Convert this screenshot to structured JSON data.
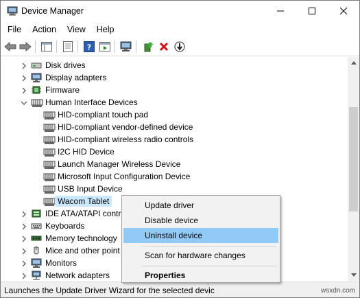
{
  "window": {
    "title": "Device Manager"
  },
  "menu": [
    "File",
    "Action",
    "View",
    "Help"
  ],
  "tree": {
    "rows": [
      {
        "label": "Disk drives",
        "expander": "collapsed",
        "icon": "disk-icon",
        "indent": 0
      },
      {
        "label": "Display adapters",
        "expander": "collapsed",
        "icon": "monitor-icon",
        "indent": 0
      },
      {
        "label": "Firmware",
        "expander": "collapsed",
        "icon": "chip-icon",
        "indent": 0
      },
      {
        "label": "Human Interface Devices",
        "expander": "expanded",
        "icon": "hid-icon",
        "indent": 0
      },
      {
        "label": "HID-compliant touch pad",
        "expander": "none",
        "icon": "hid-icon",
        "indent": 1
      },
      {
        "label": "HID-compliant vendor-defined device",
        "expander": "none",
        "icon": "hid-icon",
        "indent": 1
      },
      {
        "label": "HID-compliant wireless radio controls",
        "expander": "none",
        "icon": "hid-icon",
        "indent": 1
      },
      {
        "label": "I2C HID Device",
        "expander": "none",
        "icon": "hid-icon",
        "indent": 1
      },
      {
        "label": "Launch Manager Wireless Device",
        "expander": "none",
        "icon": "hid-icon",
        "indent": 1
      },
      {
        "label": "Microsoft Input Configuration Device",
        "expander": "none",
        "icon": "hid-icon",
        "indent": 1
      },
      {
        "label": "USB Input Device",
        "expander": "none",
        "icon": "hid-icon",
        "indent": 1
      },
      {
        "label": "Wacom Tablet",
        "expander": "none",
        "icon": "hid-icon",
        "indent": 1,
        "selected": true
      },
      {
        "label": "IDE ATA/ATAPI contro",
        "expander": "collapsed",
        "icon": "ide-icon",
        "indent": 0
      },
      {
        "label": "Keyboards",
        "expander": "collapsed",
        "icon": "keyboard-icon",
        "indent": 0
      },
      {
        "label": "Memory technology",
        "expander": "collapsed",
        "icon": "memory-icon",
        "indent": 0
      },
      {
        "label": "Mice and other point",
        "expander": "collapsed",
        "icon": "mouse-icon",
        "indent": 0
      },
      {
        "label": "Monitors",
        "expander": "collapsed",
        "icon": "monitor-icon",
        "indent": 0
      },
      {
        "label": "Network adapters",
        "expander": "collapsed",
        "icon": "network-icon",
        "indent": 0
      }
    ]
  },
  "context_menu": {
    "items": [
      {
        "label": "Update driver"
      },
      {
        "label": "Disable device"
      },
      {
        "label": "Uninstall device",
        "highlighted": true
      },
      {
        "label": "Scan for hardware changes"
      },
      {
        "label": "Properties",
        "bold": true
      }
    ]
  },
  "status": {
    "text": "Launches the Update Driver Wizard for the selected devic"
  },
  "watermark": "wsxdn.com",
  "colors": {
    "selection": "#cce8ff",
    "menu_highlight": "#91c9f7",
    "uninstall_red": "#d01010"
  }
}
